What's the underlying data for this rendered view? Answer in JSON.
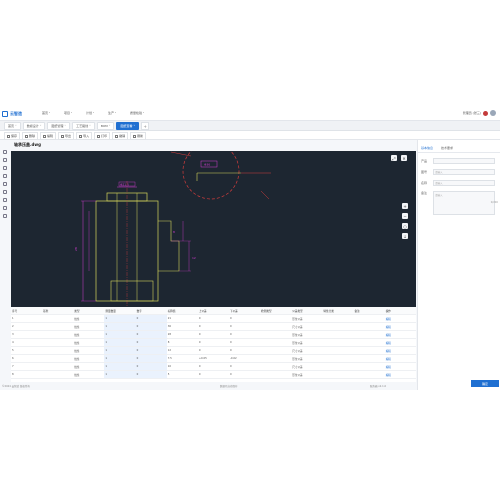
{
  "app": {
    "name": "云智造"
  },
  "nav": {
    "items": [
      "首页",
      "项目",
      "计划",
      "生产",
      "质量检验"
    ],
    "user_text": "管理员 (张三)"
  },
  "tabs": [
    {
      "label": "首页",
      "active": false
    },
    {
      "label": "数模设计",
      "active": false
    },
    {
      "label": "图纸管理",
      "active": false
    },
    {
      "label": "工艺路线",
      "active": false
    },
    {
      "label": "BOM",
      "active": false
    },
    {
      "label": "图纸查看",
      "active": true
    }
  ],
  "toolbar": {
    "tools": [
      "保存",
      "删除",
      "编辑",
      "导出",
      "导入",
      "打印",
      "撤销",
      "刷新"
    ]
  },
  "file": {
    "title": "轴承压盖.dwg"
  },
  "drawing": {
    "dim_top": "Φ21.5",
    "dim_body": "Φ36",
    "dim_left_height": "28",
    "dim_step": "8",
    "dim_right_height": "12"
  },
  "table": {
    "headers": [
      "序号",
      "基准",
      "类型",
      "测量数量",
      "数字",
      "标称值",
      "上公差",
      "下公差",
      "检测类型",
      "公差类型",
      "特性分类",
      "备注",
      "操作"
    ],
    "rows": [
      [
        "1",
        "",
        "线性",
        "1",
        "0",
        "21",
        "0",
        "0",
        "",
        "形位公差",
        "",
        "",
        "编辑"
      ],
      [
        "2",
        "",
        "线性",
        "1",
        "0",
        "36",
        "0",
        "0",
        "",
        "尺寸公差",
        "",
        "",
        "编辑"
      ],
      [
        "3",
        "",
        "线性",
        "1",
        "0",
        "28",
        "0",
        "0",
        "",
        "形位公差",
        "",
        "",
        "编辑"
      ],
      [
        "4",
        "",
        "线性",
        "1",
        "0",
        "8",
        "0",
        "0",
        "",
        "形位公差",
        "",
        "",
        "编辑"
      ],
      [
        "5",
        "",
        "线性",
        "1",
        "0",
        "12",
        "0",
        "0",
        "",
        "尺寸公差",
        "",
        "",
        "编辑"
      ],
      [
        "6",
        "",
        "线性",
        "1",
        "0",
        "7.5",
        "+0.05",
        "-0.02",
        "",
        "形位公差",
        "",
        "",
        "编辑"
      ],
      [
        "7",
        "",
        "线性",
        "1",
        "0",
        "10",
        "0",
        "0",
        "",
        "尺寸公差",
        "",
        "",
        "编辑"
      ],
      [
        "8",
        "",
        "线性",
        "1",
        "0",
        "5",
        "0",
        "0",
        "",
        "形位公差",
        "",
        "",
        "编辑"
      ]
    ]
  },
  "right_panel": {
    "tabs": [
      "基本信息",
      "技术要求"
    ],
    "fields": [
      {
        "label": "产品",
        "value": ""
      },
      {
        "label": "图号",
        "value": "请输入"
      },
      {
        "label": "名称",
        "value": "请输入"
      }
    ],
    "remark_label": "备注",
    "remark_placeholder": "请输入",
    "counter": "0/200",
    "confirm_label": "确定"
  },
  "status": {
    "left": "©2024 云智造 版权所有",
    "mid": "数据已自动保存",
    "right": "服务器 v2.1.0"
  },
  "colors": {
    "accent": "#1f6fd1",
    "canvas_bg": "#1d2631",
    "dim_magenta": "#d23cd2",
    "line_yellow": "#d6d65c",
    "line_red": "#d23c3c"
  }
}
